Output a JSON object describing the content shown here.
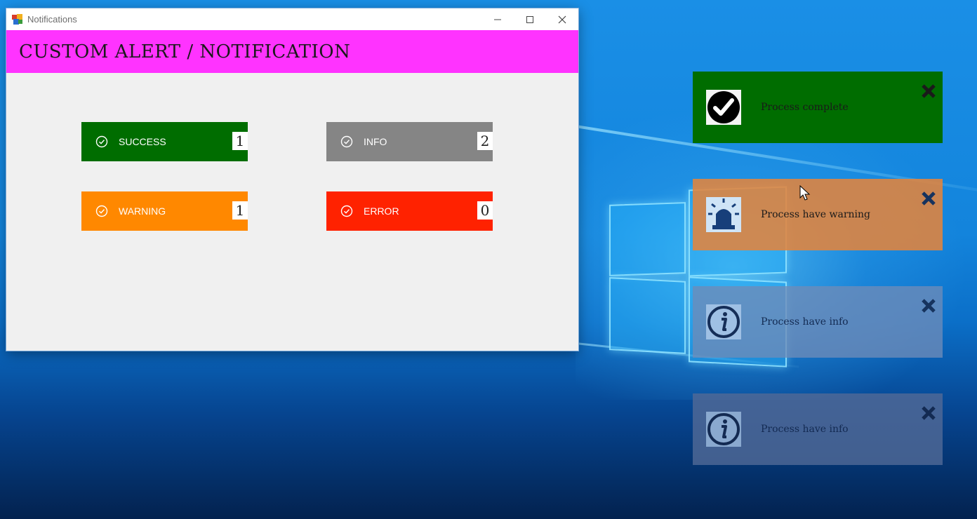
{
  "window": {
    "title": "Notifications",
    "controls": {
      "minimize": "—",
      "maximize": "☐",
      "close": "✕"
    },
    "header": "CUSTOM ALERT / NOTIFICATION"
  },
  "buttons": [
    {
      "label": "SUCCESS",
      "count": "1",
      "color": "#006d00"
    },
    {
      "label": "INFO",
      "count": "2",
      "color": "#858585"
    },
    {
      "label": "WARNING",
      "count": "1",
      "color": "#ff8800"
    },
    {
      "label": "ERROR",
      "count": "0",
      "color": "#ff2200"
    }
  ],
  "toasts": [
    {
      "message": "Process complete",
      "type": "success",
      "icon": "checkmark-icon",
      "color": "#006d00"
    },
    {
      "message": "Process have warning",
      "type": "warning",
      "icon": "siren-icon",
      "color": "#c88048"
    },
    {
      "message": "Process have info",
      "type": "info",
      "icon": "info-icon",
      "color": "#5c80b8"
    },
    {
      "message": "Process have info",
      "type": "info",
      "icon": "info-icon",
      "color": "#4a6aa0"
    }
  ]
}
